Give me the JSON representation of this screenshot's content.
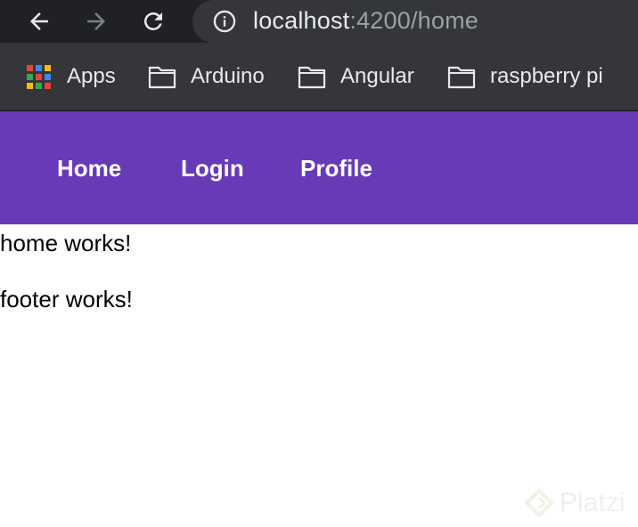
{
  "browser": {
    "url_host": "localhost",
    "url_path": ":4200/home",
    "nav_icons": [
      "back-arrow-icon",
      "forward-arrow-icon",
      "reload-icon",
      "info-icon"
    ]
  },
  "bookmarks": [
    {
      "label": "Apps",
      "icon": "apps-grid-icon"
    },
    {
      "label": "Arduino",
      "icon": "folder-icon"
    },
    {
      "label": "Angular",
      "icon": "folder-icon"
    },
    {
      "label": "raspberry pi",
      "icon": "folder-icon"
    }
  ],
  "app_nav": {
    "items": [
      "Home",
      "Login",
      "Profile"
    ]
  },
  "main": {
    "home_text": "home works!"
  },
  "footer": {
    "text": "footer works!"
  },
  "watermark": {
    "text": "Platzi"
  },
  "colors": {
    "toolbar": "#202124",
    "bookmarks_bar": "#35363a",
    "nav_background": "#673ab7",
    "url_dim": "#9aa0a6"
  }
}
